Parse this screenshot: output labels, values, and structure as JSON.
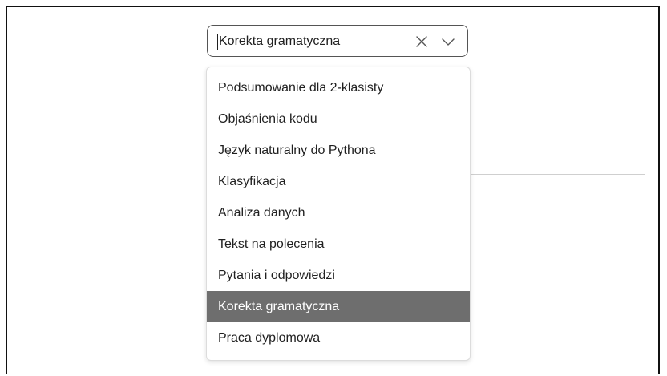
{
  "select": {
    "value": "Korekta gramatyczna",
    "clear_icon": "close-icon",
    "toggle_icon": "chevron-down-icon"
  },
  "options": [
    {
      "label": "Podsumowanie dla 2-klasisty",
      "selected": false
    },
    {
      "label": "Objaśnienia kodu",
      "selected": false
    },
    {
      "label": "Język naturalny do Pythona",
      "selected": false
    },
    {
      "label": "Klasyfikacja",
      "selected": false
    },
    {
      "label": "Analiza danych",
      "selected": false
    },
    {
      "label": "Tekst na polecenia",
      "selected": false
    },
    {
      "label": "Pytania i odpowiedzi",
      "selected": false
    },
    {
      "label": "Korekta gramatyczna",
      "selected": true
    },
    {
      "label": "Praca dyplomowa",
      "selected": false
    }
  ],
  "colors": {
    "selected_background": "#6e6e6e",
    "selected_text": "#ffffff",
    "border": "#555555"
  }
}
